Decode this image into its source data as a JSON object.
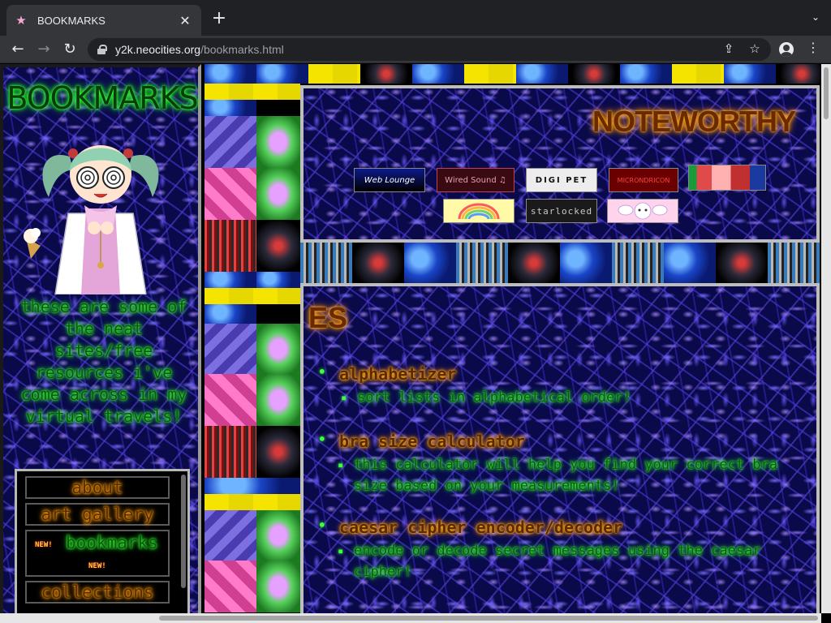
{
  "browser": {
    "tab": {
      "title": "BOOKMARKS",
      "favicon": "pink-star-icon"
    },
    "url_host": "y2k.neocities.org",
    "url_path": "/bookmarks.html"
  },
  "sidebar": {
    "title": "BOOKMARKS",
    "blurb": "these are some of the neat sites/free resources i've come across in my virtual travels!",
    "nav": [
      {
        "label": "about"
      },
      {
        "label": "art gallery"
      },
      {
        "label": "bookmarks",
        "badge": "NEW!"
      },
      {
        "label": "collections"
      }
    ]
  },
  "noteworthy": {
    "title": "NOTEWORTHY",
    "badges": [
      {
        "text": "Web Lounge"
      },
      {
        "text": "Wired Sound"
      },
      {
        "text": "DIGI PET"
      },
      {
        "text": "MICRONDRICON"
      },
      {
        "text": ""
      },
      {
        "text": ""
      },
      {
        "text": "starlocked"
      },
      {
        "text": ""
      }
    ]
  },
  "pages": {
    "heading": "ES",
    "entries": [
      {
        "title": "alphabetizer",
        "desc": "sort lists in alphabetical order!"
      },
      {
        "title": "bra size calculator",
        "desc": "this calculator will help you find your correct bra size based on your measurements!"
      },
      {
        "title": "caesar cipher encoder/decoder",
        "desc": "encode or decode secret messages using the caesar cipher!"
      }
    ]
  },
  "colors": {
    "neon_green": "#3dff3d",
    "neon_orange": "#ffa000",
    "panel_border": "#bdbdbd",
    "lightning_bg": "#0a0a4a"
  }
}
